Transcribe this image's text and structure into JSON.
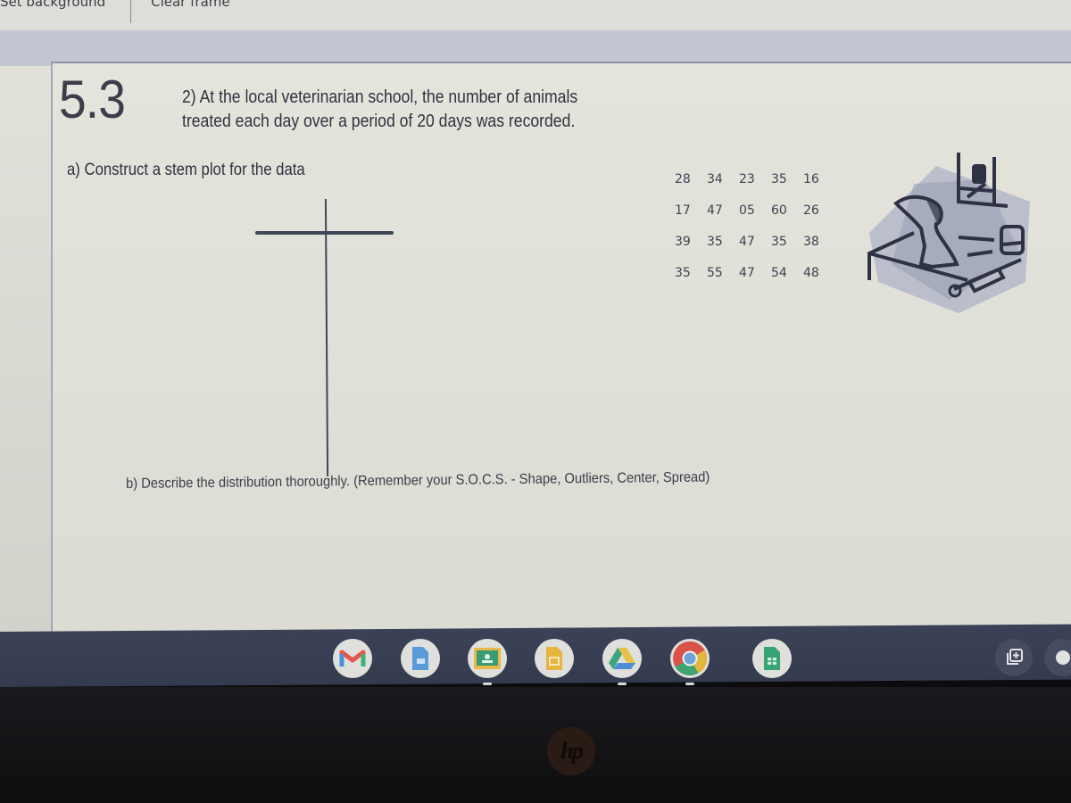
{
  "toolbar": {
    "set_background": "Set background",
    "clear_frame": "Clear frame"
  },
  "slide": {
    "section_number": "5.3",
    "prompt_line1": "2) At the local veterinarian school, the number of animals",
    "prompt_line2": "treated each day over a period of 20 days was recorded.",
    "part_a": "a) Construct a stem plot for the data",
    "part_b": "b) Describe the distribution thoroughly. (Remember your S.O.C.S. - Shape, Outliers, Center, Spread)",
    "data_rows": [
      [
        "28",
        "34",
        "23",
        "35",
        "16"
      ],
      [
        "17",
        "47",
        "05",
        "60",
        "26"
      ],
      [
        "39",
        "35",
        "47",
        "35",
        "38"
      ],
      [
        "35",
        "55",
        "47",
        "54",
        "48"
      ]
    ],
    "clipart_icon": "vet-dog-syringe-icon"
  },
  "shelf": {
    "apps": [
      {
        "name": "gmail",
        "icon": "gmail-icon",
        "running": false
      },
      {
        "name": "docs",
        "icon": "docs-icon",
        "running": false
      },
      {
        "name": "classroom",
        "icon": "classroom-icon",
        "running": true
      },
      {
        "name": "slides",
        "icon": "slides-icon",
        "running": false
      },
      {
        "name": "drive",
        "icon": "drive-icon",
        "running": true
      },
      {
        "name": "chrome",
        "icon": "chrome-icon",
        "running": true
      },
      {
        "name": "sheets",
        "icon": "sheets-icon",
        "running": false
      }
    ],
    "tray": [
      {
        "name": "virtual-desks",
        "icon": "add-desk-icon"
      },
      {
        "name": "status",
        "icon": "status-icon"
      }
    ]
  },
  "bezel": {
    "brand": "hp"
  },
  "colors": {
    "text": "#2f3240",
    "shelf": "#3b4257",
    "frame_band": "#c3c7d3"
  }
}
